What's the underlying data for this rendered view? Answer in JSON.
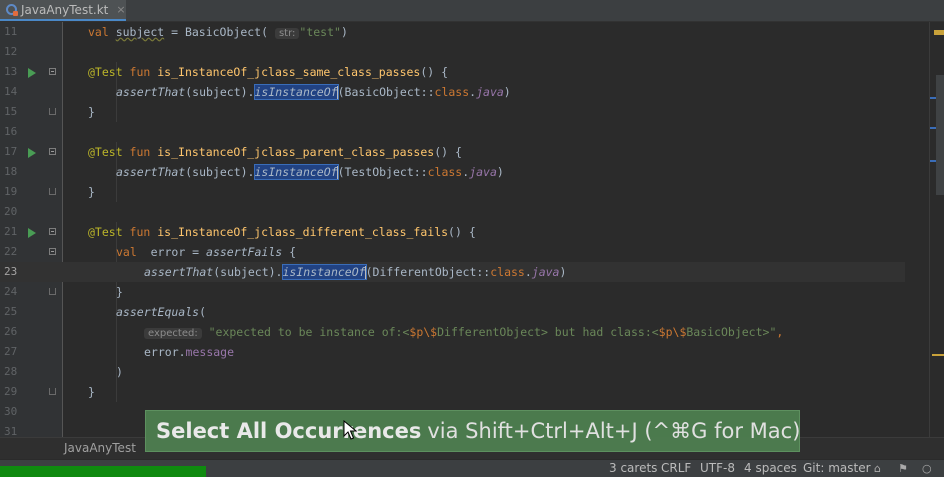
{
  "tab": {
    "filename": "JavaAnyTest.kt",
    "close": "×"
  },
  "lines": [
    {
      "n": "11"
    },
    {
      "n": "12"
    },
    {
      "n": "13"
    },
    {
      "n": "14"
    },
    {
      "n": "15"
    },
    {
      "n": "16"
    },
    {
      "n": "17"
    },
    {
      "n": "18"
    },
    {
      "n": "19"
    },
    {
      "n": "20"
    },
    {
      "n": "21"
    },
    {
      "n": "22"
    },
    {
      "n": "23"
    },
    {
      "n": "24"
    },
    {
      "n": "25"
    },
    {
      "n": "26"
    },
    {
      "n": "27"
    },
    {
      "n": "28"
    },
    {
      "n": "29"
    },
    {
      "n": "30"
    },
    {
      "n": "31"
    }
  ],
  "code": {
    "l11": {
      "val": "val ",
      "name": "subject",
      "eq": " = BasicObject( ",
      "hint": "str:",
      "str": "\"test\"",
      "close": ")"
    },
    "l13": {
      "ann": "@Test",
      "fun": " fun ",
      "name": "is_InstanceOf_jclass_same_class_passes",
      "rest": "() {"
    },
    "l14": {
      "call": "assertThat",
      "args": "(subject).",
      "sel": "isInstanceOf",
      "open": "(BasicObject::",
      "kw": "class",
      "dot": ".",
      "java": "java",
      "close": ")"
    },
    "l15": {
      "text": "}"
    },
    "l17": {
      "ann": "@Test",
      "fun": " fun ",
      "name": "is_InstanceOf_jclass_parent_class_passes",
      "rest": "() {"
    },
    "l18": {
      "call": "assertThat",
      "args": "(subject).",
      "sel": "isInstanceOf",
      "open": "(TestObject::",
      "kw": "class",
      "dot": ".",
      "java": "java",
      "close": ")"
    },
    "l19": {
      "text": "}"
    },
    "l21": {
      "ann": "@Test",
      "fun": " fun ",
      "name": "is_InstanceOf_jclass_different_class_fails",
      "rest": "() {"
    },
    "l22": {
      "val": "val ",
      "name": " error = ",
      "call": "assertFails",
      "rest": " {"
    },
    "l23": {
      "call": "assertThat",
      "args": "(subject).",
      "sel": "isInstanceOf",
      "open": "(DifferentObject::",
      "kw": "class",
      "dot": ".",
      "java": "java",
      "close": ")"
    },
    "l24": {
      "text": "}"
    },
    "l25": {
      "call": "assertEquals",
      "rest": "("
    },
    "l26": {
      "hint": "expected:",
      "s1": " \"expected to be instance of:<",
      "e1": "$p\\$",
      "s2": "DifferentObject> but had class:<",
      "e2": "$p\\$",
      "s3": "BasicObject>\"",
      "comma": ","
    },
    "l27": {
      "obj": "error.",
      "prop": "message"
    },
    "l28": {
      "text": ")"
    },
    "l29": {
      "text": "}"
    }
  },
  "breadcrumb": {
    "path": "JavaAnyTest"
  },
  "status": {
    "carets": "3 carets",
    "line_sep": "CRLF",
    "encoding": "UTF-8",
    "indent": "4 spaces",
    "vcs": "Git: master"
  },
  "tooltip": {
    "action": "Select All Occurrences",
    "shortcut": "via Shift+Ctrl+Alt+J (^⌘G for Mac)"
  },
  "colors": {
    "background": "#2b2b2b",
    "keyword": "#cc7832",
    "annotation": "#bbb529",
    "function": "#ffc66d",
    "string": "#6a8759",
    "selection": "#214283",
    "tooltip": "#4d7d4f"
  }
}
